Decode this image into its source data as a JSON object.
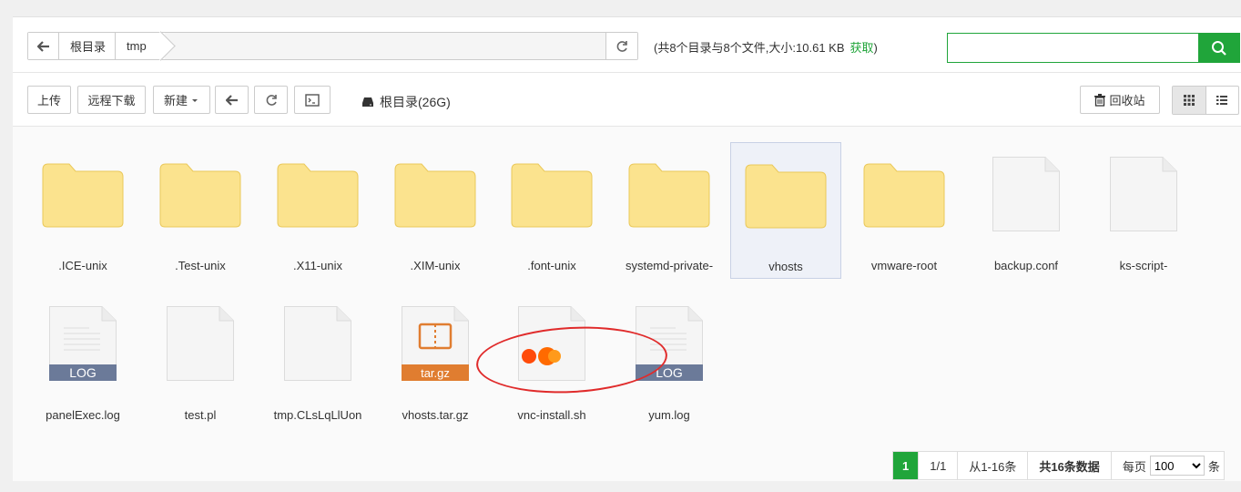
{
  "path": {
    "crumbs": [
      "根目录",
      "tmp"
    ],
    "summary": "(共8个目录与8个文件,大小:10.61 KB",
    "summary_link": "获取",
    "summary_end": ")",
    "search_placeholder": ""
  },
  "toolbar": {
    "upload": "上传",
    "remote_download": "远程下载",
    "new": "新建",
    "disk_label": "根目录(26G)",
    "recycle": "回收站"
  },
  "files": [
    {
      "name": ".ICE-unix",
      "kind": "folder"
    },
    {
      "name": ".Test-unix",
      "kind": "folder"
    },
    {
      "name": ".X11-unix",
      "kind": "folder"
    },
    {
      "name": ".XIM-unix",
      "kind": "folder"
    },
    {
      "name": ".font-unix",
      "kind": "folder"
    },
    {
      "name": "systemd-private-",
      "kind": "folder"
    },
    {
      "name": "vhosts",
      "kind": "folder",
      "selected": true
    },
    {
      "name": "vmware-root",
      "kind": "folder"
    },
    {
      "name": "backup.conf",
      "kind": "file"
    },
    {
      "name": "ks-script-",
      "kind": "file"
    },
    {
      "name": "panelExec.log",
      "kind": "log",
      "badge": "LOG"
    },
    {
      "name": "test.pl",
      "kind": "file"
    },
    {
      "name": "tmp.CLsLqLlUon",
      "kind": "file"
    },
    {
      "name": "vhosts.tar.gz",
      "kind": "archive",
      "badge": "tar.gz"
    },
    {
      "name": "vnc-install.sh",
      "kind": "script"
    },
    {
      "name": "yum.log",
      "kind": "log",
      "badge": "LOG"
    }
  ],
  "pager": {
    "current": "1",
    "pages": "1/1",
    "range": "从1-16条",
    "total": "共16条数据",
    "per_page_label": "每页",
    "per_page_value": "100",
    "unit": "条"
  },
  "colors": {
    "accent": "#20a53a",
    "folder": "#fbe38e",
    "folder_border": "#eac85a",
    "log_badge": "#6b7a99",
    "archive_badge": "#e07d30",
    "highlight_oval": "#e02b2b"
  }
}
